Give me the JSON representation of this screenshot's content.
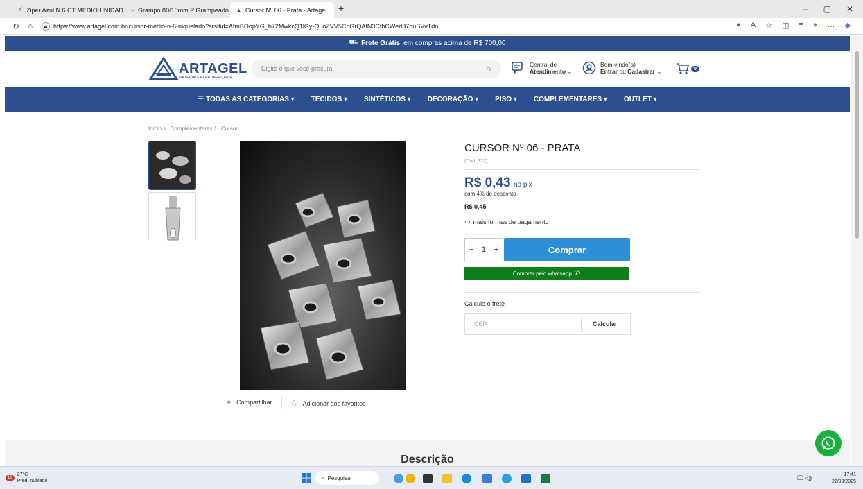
{
  "browser": {
    "tabs": [
      {
        "title": "Ziper Azul N 6 CT MEDIO UNIDAD"
      },
      {
        "title": "Grampo 80/10mm P Grampeado"
      },
      {
        "title": "Cursor Nº 06 - Prata - Artagel"
      }
    ],
    "new_tab": "+",
    "url": "https://www.artagel.com.br/cursor-medio-n-6-niquelado?srsltid=AfmBOopYG_b72MwkcQ1lGy-QLoZVV5CpGrQAtN3CfbCWed37huSVvTdn",
    "window_controls": {
      "minimize": "–",
      "maximize": "▢",
      "close": "✕"
    }
  },
  "promo": {
    "bold": "Frete Grátis",
    "text": "em compras acima de R$ 700,00"
  },
  "header": {
    "logo_name": "ARTAGEL",
    "logo_tagline": "MATERIAIS PARA TAPEÇARIA",
    "search_placeholder": "Digite o que você procura",
    "support_line1": "Central de",
    "support_line2": "Atendimento",
    "account_line1": "Bem-vindo(a)",
    "account_enter": "Entrar",
    "account_or": "ou",
    "account_register": "Cadastrar",
    "cart_count": "0"
  },
  "nav": [
    "TODAS AS CATEGORIAS",
    "TECIDOS",
    "SINTÉTICOS",
    "DECORAÇÃO",
    "PISO",
    "COMPLEMENTARES",
    "OUTLET"
  ],
  "breadcrumb": [
    "Início",
    "Complementares",
    "Cursor"
  ],
  "product": {
    "title": "CURSOR Nº 06 - PRATA",
    "code": "(Cód: 327)",
    "pix_price": "R$ 0,43",
    "pix_label": "no pix",
    "discount": "com 4% de desconto",
    "price": "R$ 0,45",
    "payment_link": "mais formas de pagamento",
    "qty_minus": "−",
    "qty_value": "1",
    "qty_plus": "+",
    "buy_label": "Comprar",
    "whatsapp_label": "Comprar pelo whatsapp",
    "shipping_label": "Calcule o frete",
    "cep_placeholder": "CEP",
    "calc_label": "Calcular",
    "share_label": "Compartilhar",
    "favorite_label": "Adicionar aos favoritos"
  },
  "section": {
    "description_title": "Descrição"
  },
  "taskbar": {
    "weather_temp": "27°C",
    "weather_desc": "Pred. nublado",
    "search_label": "Pesquisar",
    "time": "17:41",
    "date": "22/09/2025",
    "notif_count": "16"
  },
  "colors": {
    "brand_blue": "#2c4f8f",
    "buy_blue": "#2d8fd5",
    "whatsapp_green": "#0f7d1c"
  }
}
